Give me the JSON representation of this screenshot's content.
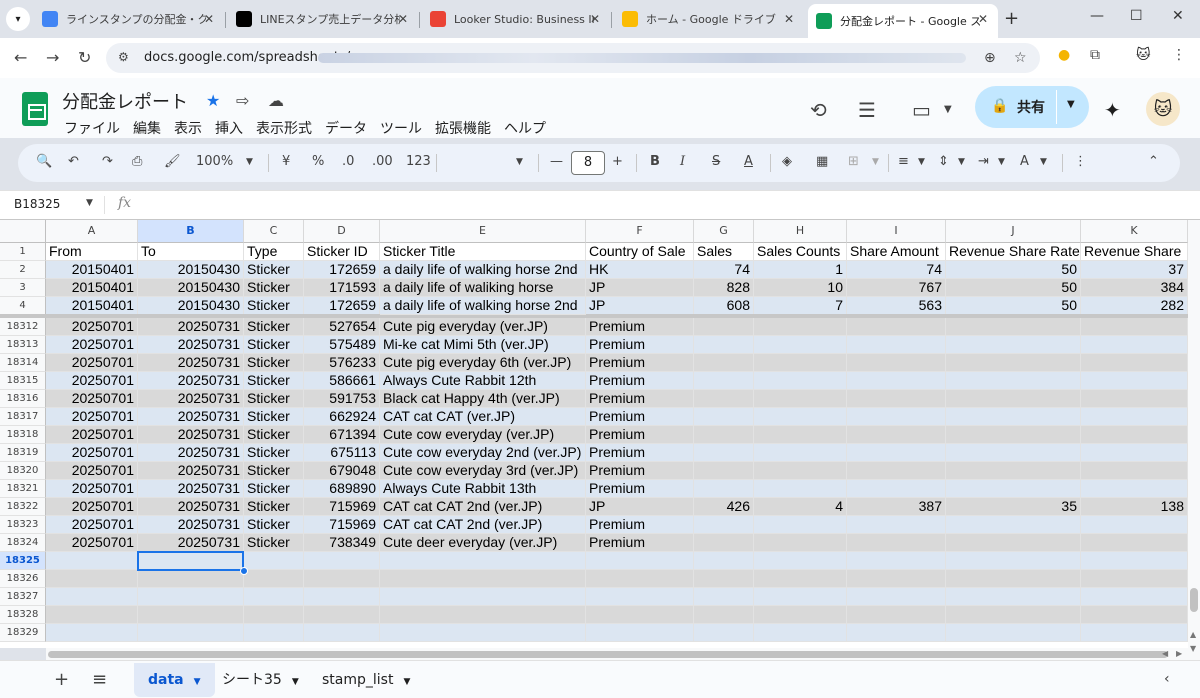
{
  "browser": {
    "tabs": [
      {
        "title": "ラインスタンプの分配金・クリエ",
        "favicon": "line-brand-icon",
        "color": "#4285f4",
        "active": false
      },
      {
        "title": "LINEスタンプ売上データ分析の",
        "favicon": "notion-icon",
        "color": "#000000",
        "active": false
      },
      {
        "title": "Looker Studio: Business Ins",
        "favicon": "google-icon",
        "color": "#ea4335",
        "active": false
      },
      {
        "title": "ホーム - Google ドライブ",
        "favicon": "drive-icon",
        "color": "#fbbc04",
        "active": false
      },
      {
        "title": "分配金レポート - Google スプ",
        "favicon": "sheets-icon",
        "color": "#0f9d58",
        "active": true
      }
    ],
    "url": "docs.google.com/spreadsheets/"
  },
  "doc": {
    "title": "分配金レポート",
    "share_label": "共有",
    "menu": [
      "ファイル",
      "編集",
      "表示",
      "挿入",
      "表示形式",
      "データ",
      "ツール",
      "拡張機能",
      "ヘルプ"
    ]
  },
  "toolbar": {
    "zoom": "100%",
    "currency": "¥",
    "percent": "%",
    "dec_decrease": ".0",
    "dec_increase": ".00",
    "format_123": "123",
    "font_size": "8",
    "bold": "B",
    "italic": "I",
    "strike": "S",
    "text_color": "A"
  },
  "formula_bar": {
    "name_box": "B18325",
    "fx": "fx",
    "value": ""
  },
  "grid": {
    "columns": [
      "A",
      "B",
      "C",
      "D",
      "E",
      "F",
      "G",
      "H",
      "I",
      "J",
      "K"
    ],
    "selected_column": "B",
    "selected_row": "18325",
    "header_row": {
      "num": "1",
      "cells": [
        "From",
        "To",
        "Type",
        "Sticker ID",
        "Sticker Title",
        "Country of Sale",
        "Sales",
        "Sales Counts",
        "Share Amount",
        "Revenue Share Rate",
        "Revenue Share"
      ]
    },
    "top_rows": [
      {
        "num": "2",
        "cells": [
          "20150401",
          "20150430",
          "Sticker",
          "172659",
          "a daily life of walking horse  2nd",
          "HK",
          "74",
          "1",
          "74",
          "50",
          "37"
        ]
      },
      {
        "num": "3",
        "cells": [
          "20150401",
          "20150430",
          "Sticker",
          "171593",
          "a daily life of waliking horse",
          "JP",
          "828",
          "10",
          "767",
          "50",
          "384"
        ]
      },
      {
        "num": "4",
        "cells": [
          "20150401",
          "20150430",
          "Sticker",
          "172659",
          "a daily life of walking horse  2nd",
          "JP",
          "608",
          "7",
          "563",
          "50",
          "282"
        ]
      }
    ],
    "rows": [
      {
        "num": "18312",
        "cells": [
          "20250701",
          "20250731",
          "Sticker",
          "527654",
          "Cute pig everyday (ver.JP)",
          "Premium",
          "",
          "",
          "",
          "",
          ""
        ]
      },
      {
        "num": "18313",
        "cells": [
          "20250701",
          "20250731",
          "Sticker",
          "575489",
          "Mi-ke cat Mimi 5th (ver.JP)",
          "Premium",
          "",
          "",
          "",
          "",
          ""
        ]
      },
      {
        "num": "18314",
        "cells": [
          "20250701",
          "20250731",
          "Sticker",
          "576233",
          "Cute pig everyday 6th (ver.JP)",
          "Premium",
          "",
          "",
          "",
          "",
          ""
        ]
      },
      {
        "num": "18315",
        "cells": [
          "20250701",
          "20250731",
          "Sticker",
          "586661",
          "Always Cute Rabbit 12th",
          "Premium",
          "",
          "",
          "",
          "",
          ""
        ]
      },
      {
        "num": "18316",
        "cells": [
          "20250701",
          "20250731",
          "Sticker",
          "591753",
          "Black cat Happy 4th (ver.JP)",
          "Premium",
          "",
          "",
          "",
          "",
          ""
        ]
      },
      {
        "num": "18317",
        "cells": [
          "20250701",
          "20250731",
          "Sticker",
          "662924",
          "CAT cat CAT (ver.JP)",
          "Premium",
          "",
          "",
          "",
          "",
          ""
        ]
      },
      {
        "num": "18318",
        "cells": [
          "20250701",
          "20250731",
          "Sticker",
          "671394",
          "Cute cow everyday (ver.JP)",
          "Premium",
          "",
          "",
          "",
          "",
          ""
        ]
      },
      {
        "num": "18319",
        "cells": [
          "20250701",
          "20250731",
          "Sticker",
          "675113",
          "Cute cow everyday 2nd (ver.JP)",
          "Premium",
          "",
          "",
          "",
          "",
          ""
        ]
      },
      {
        "num": "18320",
        "cells": [
          "20250701",
          "20250731",
          "Sticker",
          "679048",
          "Cute cow everyday 3rd (ver.JP)",
          "Premium",
          "",
          "",
          "",
          "",
          ""
        ]
      },
      {
        "num": "18321",
        "cells": [
          "20250701",
          "20250731",
          "Sticker",
          "689890",
          "Always Cute Rabbit 13th",
          "Premium",
          "",
          "",
          "",
          "",
          ""
        ]
      },
      {
        "num": "18322",
        "cells": [
          "20250701",
          "20250731",
          "Sticker",
          "715969",
          "CAT cat CAT 2nd (ver.JP)",
          "JP",
          "426",
          "4",
          "387",
          "35",
          "138"
        ]
      },
      {
        "num": "18323",
        "cells": [
          "20250701",
          "20250731",
          "Sticker",
          "715969",
          "CAT cat CAT 2nd (ver.JP)",
          "Premium",
          "",
          "",
          "",
          "",
          ""
        ]
      },
      {
        "num": "18324",
        "cells": [
          "20250701",
          "20250731",
          "Sticker",
          "738349",
          "Cute deer everyday (ver.JP)",
          "Premium",
          "",
          "",
          "",
          "",
          ""
        ]
      },
      {
        "num": "18325",
        "cells": [
          "",
          "",
          "",
          "",
          "",
          "",
          "",
          "",
          "",
          "",
          ""
        ]
      },
      {
        "num": "18326",
        "cells": [
          "",
          "",
          "",
          "",
          "",
          "",
          "",
          "",
          "",
          "",
          ""
        ]
      },
      {
        "num": "18327",
        "cells": [
          "",
          "",
          "",
          "",
          "",
          "",
          "",
          "",
          "",
          "",
          ""
        ]
      },
      {
        "num": "18328",
        "cells": [
          "",
          "",
          "",
          "",
          "",
          "",
          "",
          "",
          "",
          "",
          ""
        ]
      },
      {
        "num": "18329",
        "cells": [
          "",
          "",
          "",
          "",
          "",
          "",
          "",
          "",
          "",
          "",
          ""
        ]
      }
    ]
  },
  "sheet_tabs": [
    {
      "label": "data",
      "active": true
    },
    {
      "label": "シート35",
      "active": false
    },
    {
      "label": "stamp_list",
      "active": false
    }
  ],
  "colors": {
    "accent": "#0b57d0",
    "sheets_green": "#0f9d58",
    "band_gray": "#d9d9d9",
    "band_blue": "#dce6f2",
    "selection": "#1a73e8"
  }
}
